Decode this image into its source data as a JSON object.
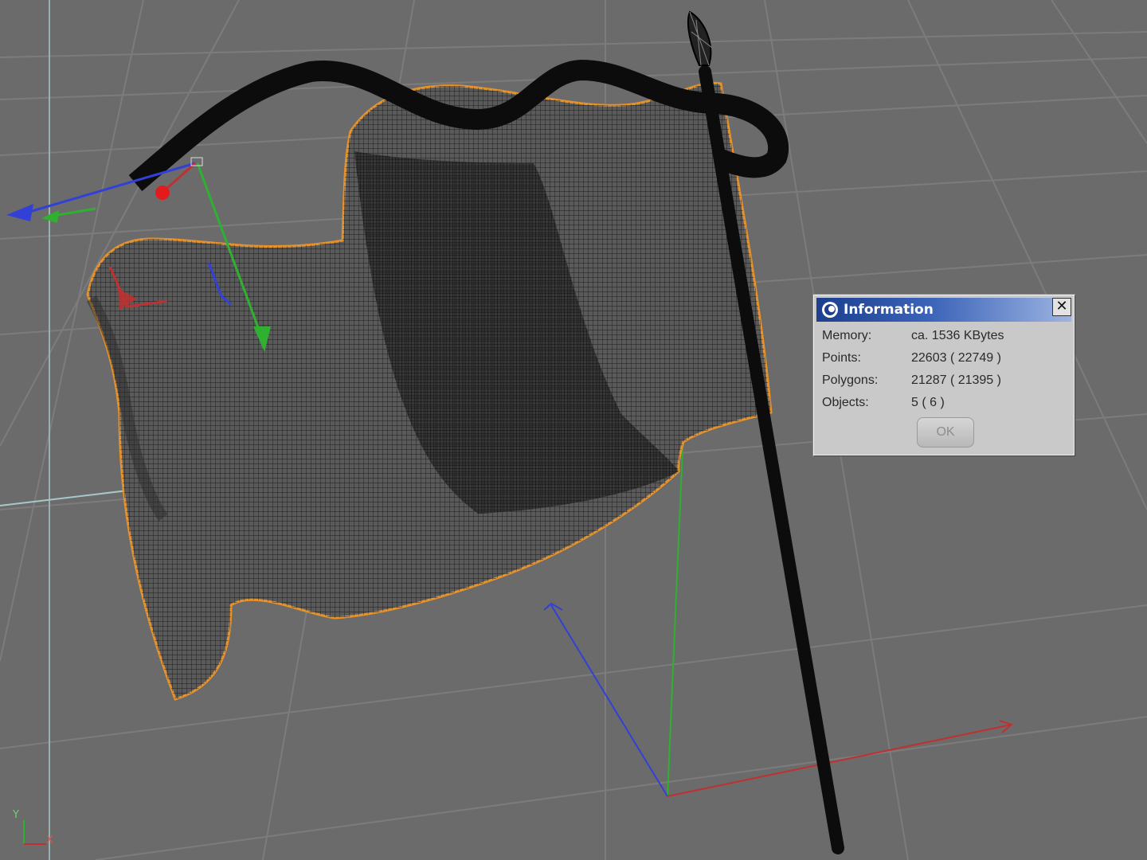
{
  "dialog": {
    "title": "Information",
    "close_label": "✕",
    "rows": [
      {
        "label": "Memory:",
        "value": "ca. 1536 KBytes"
      },
      {
        "label": "Points:",
        "value": "22603 ( 22749 )"
      },
      {
        "label": "Polygons:",
        "value": "21287 ( 21395 )"
      },
      {
        "label": "Objects:",
        "value": "5 ( 6 )"
      }
    ],
    "ok_label": "OK"
  },
  "axis_labels": {
    "y": "Y",
    "x": "X"
  },
  "colors": {
    "viewport_bg": "#6b6b6b",
    "grid": "#7a7a7a",
    "mesh": "#111111",
    "selection_outline": "#e8922a",
    "axis_x": "#c03030",
    "axis_y": "#30b030",
    "axis_z": "#3340d8",
    "title_bar": "#2a4fa0"
  },
  "icons": {
    "title_icon": "cinema4d-logo-icon",
    "close_icon": "close-icon"
  }
}
